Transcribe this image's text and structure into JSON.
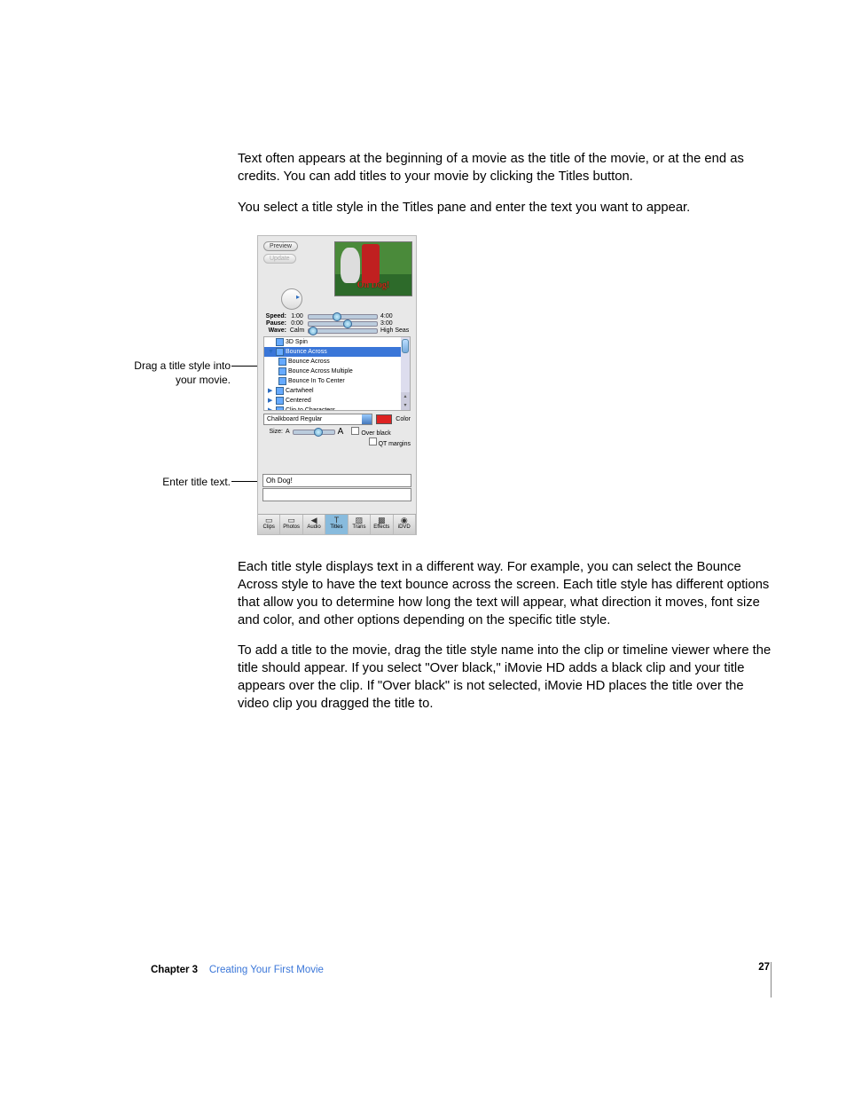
{
  "paragraphs": {
    "p1": "Text often appears at the beginning of a movie as the title of the movie, or at the end as credits. You can add titles to your movie by clicking the Titles button.",
    "p2": "You select a title style in the Titles pane and enter the text you want to appear.",
    "p3": "Each title style displays text in a different way. For example, you can select the Bounce Across style to have the text bounce across the screen. Each title style has different options that allow you to determine how long the text will appear, what direction it moves, font size and color, and other options depending on the specific title style.",
    "p4": "To add a title to the movie, drag the title style name into the clip or timeline viewer where the title should appear. If you select \"Over black,\" iMovie HD adds a black clip and your title appears over the clip. If \"Over black\" is not selected, iMovie HD places the title over the video clip you dragged the title to."
  },
  "callouts": {
    "drag": "Drag a title style into your movie.",
    "enter": "Enter title text."
  },
  "panel": {
    "buttons": {
      "preview": "Preview",
      "update": "Update"
    },
    "preview_title_text": "Oh Dog!",
    "sliders": {
      "speed": {
        "label": "Speed:",
        "min": "1:00",
        "max": "4:00"
      },
      "pause": {
        "label": "Pause:",
        "min": "0:00",
        "max": "3:00"
      },
      "wave": {
        "label": "Wave:",
        "min": "Calm",
        "max": "High Seas"
      }
    },
    "styles": [
      "3D Spin",
      "Bounce Across",
      "Bounce Across",
      "Bounce Across Multiple",
      "Bounce In To Center",
      "Cartwheel",
      "Centered",
      "Clip to Characters"
    ],
    "font": "Chalkboard Regular",
    "color_label": "Color",
    "size_label": "Size:",
    "over_black": "Over black",
    "qt_margins": "QT margins",
    "title_text": "Oh Dog!",
    "tabs": [
      "Clips",
      "Photos",
      "Audio",
      "Titles",
      "Trans",
      "Effects",
      "iDVD"
    ]
  },
  "footer": {
    "chapter_label": "Chapter 3",
    "chapter_title": "Creating Your First Movie",
    "page": "27"
  }
}
